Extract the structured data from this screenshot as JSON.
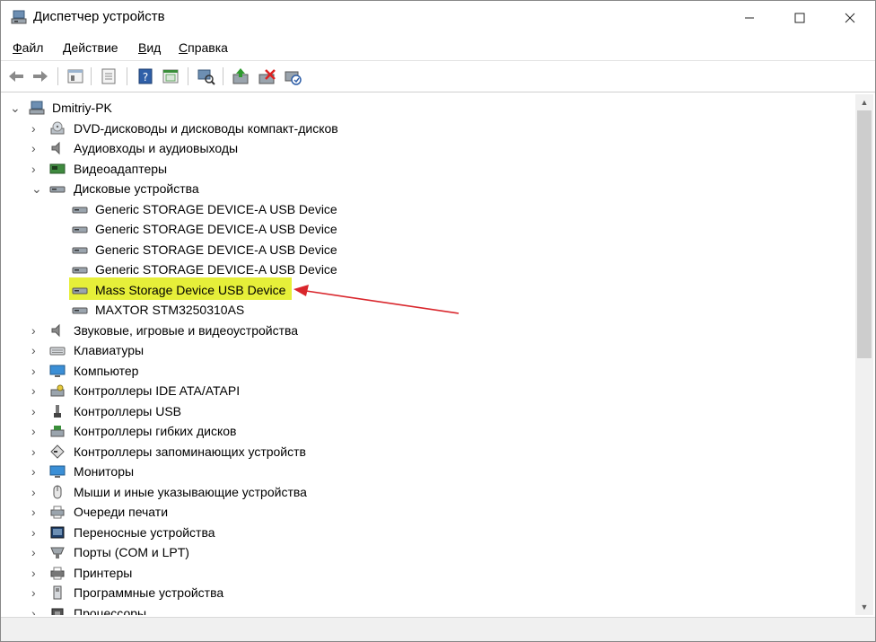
{
  "window": {
    "title": "Диспетчер устройств",
    "icon": "device-manager-icon"
  },
  "menu": {
    "file": {
      "u": "Ф",
      "rest": "айл"
    },
    "action": {
      "u": "Д",
      "rest": "ействие"
    },
    "view": {
      "u": "В",
      "rest": "ид"
    },
    "help": {
      "u": "С",
      "rest": "правка"
    }
  },
  "toolbar": [
    "back-icon",
    "forward-icon",
    "properties-icon",
    "show-hidden-icon",
    "help-icon",
    "resources-icon",
    "scan-hardware-icon",
    "update-driver-icon",
    "uninstall-icon",
    "disable-icon"
  ],
  "tree": {
    "root": "Dmitriy-PK",
    "items": [
      {
        "label": "DVD-дисководы и дисководы компакт-дисков",
        "icon": "dvd-icon",
        "expanded": false
      },
      {
        "label": "Аудиовходы и аудиовыходы",
        "icon": "speaker-icon",
        "expanded": false
      },
      {
        "label": "Видеоадаптеры",
        "icon": "display-adapter-icon",
        "expanded": false
      },
      {
        "label": "Дисковые устройства",
        "icon": "disk-icon",
        "expanded": true,
        "children": [
          {
            "label": "Generic STORAGE DEVICE-A USB Device"
          },
          {
            "label": "Generic STORAGE DEVICE-A USB Device"
          },
          {
            "label": "Generic STORAGE DEVICE-A USB Device"
          },
          {
            "label": "Generic STORAGE DEVICE-A USB Device"
          },
          {
            "label": "Mass Storage Device USB Device",
            "highlighted": true
          },
          {
            "label": "MAXTOR STM3250310AS"
          }
        ]
      },
      {
        "label": "Звуковые, игровые и видеоустройства",
        "icon": "sound-icon",
        "expanded": false
      },
      {
        "label": "Клавиатуры",
        "icon": "keyboard-icon",
        "expanded": false
      },
      {
        "label": "Компьютер",
        "icon": "computer-icon",
        "expanded": false
      },
      {
        "label": "Контроллеры IDE ATA/ATAPI",
        "icon": "ide-controller-icon",
        "expanded": false
      },
      {
        "label": "Контроллеры USB",
        "icon": "usb-icon",
        "expanded": false
      },
      {
        "label": "Контроллеры гибких дисков",
        "icon": "floppy-controller-icon",
        "expanded": false
      },
      {
        "label": "Контроллеры запоминающих устройств",
        "icon": "storage-controller-icon",
        "expanded": false
      },
      {
        "label": "Мониторы",
        "icon": "monitor-icon",
        "expanded": false
      },
      {
        "label": "Мыши и иные указывающие устройства",
        "icon": "mouse-icon",
        "expanded": false
      },
      {
        "label": "Очереди печати",
        "icon": "print-queue-icon",
        "expanded": false
      },
      {
        "label": "Переносные устройства",
        "icon": "portable-device-icon",
        "expanded": false
      },
      {
        "label": "Порты (COM и LPT)",
        "icon": "port-icon",
        "expanded": false
      },
      {
        "label": "Принтеры",
        "icon": "printer-icon",
        "expanded": false
      },
      {
        "label": "Программные устройства",
        "icon": "software-device-icon",
        "expanded": false
      },
      {
        "label": "Процессоры",
        "icon": "processor-icon",
        "expanded": false
      }
    ]
  },
  "colors": {
    "highlight": "#e6ef39",
    "annotation_arrow": "#d9262c"
  }
}
